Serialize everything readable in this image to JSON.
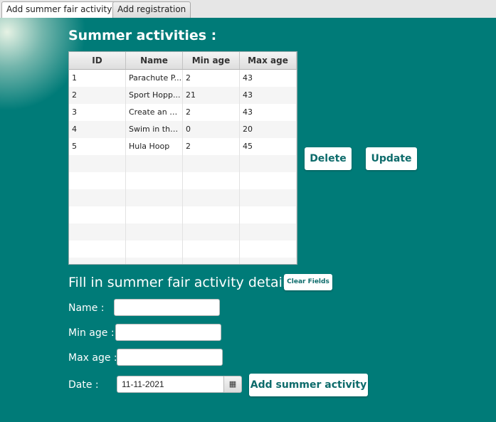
{
  "tabs": [
    {
      "label": "Add summer fair activity",
      "close": "✕"
    },
    {
      "label": "Add registration"
    }
  ],
  "heading": "Summer activities :",
  "table": {
    "columns": [
      "ID",
      "Name",
      "Min age",
      "Max age"
    ],
    "rows": [
      [
        "1",
        "Parachute P...",
        "2",
        "43"
      ],
      [
        "2",
        "Sport Hopp...",
        "21",
        "43"
      ],
      [
        "3",
        "Create an O...",
        "2",
        "43"
      ],
      [
        "4",
        "Swim in the...",
        "0",
        "20"
      ],
      [
        "5",
        "Hula Hoop",
        "2",
        "45"
      ],
      [
        "",
        "",
        "",
        ""
      ],
      [
        "",
        "",
        "",
        ""
      ],
      [
        "",
        "",
        "",
        ""
      ],
      [
        "",
        "",
        "",
        ""
      ],
      [
        "",
        "",
        "",
        ""
      ],
      [
        "",
        "",
        "",
        ""
      ],
      [
        "",
        "",
        "",
        ""
      ]
    ]
  },
  "buttons": {
    "delete": "Delete",
    "update": "Update",
    "clear_fields": "Clear Fields",
    "add_activity": "Add summer activity"
  },
  "form": {
    "title": "Fill in summer fair activity details :",
    "name_label": "Name :",
    "name_value": "",
    "min_age_label": "Min age :",
    "min_age_value": "",
    "max_age_label": "Max age :",
    "max_age_value": "",
    "date_label": "Date :",
    "date_value": "11-11-2021",
    "calendar_icon": "calendar-icon"
  }
}
